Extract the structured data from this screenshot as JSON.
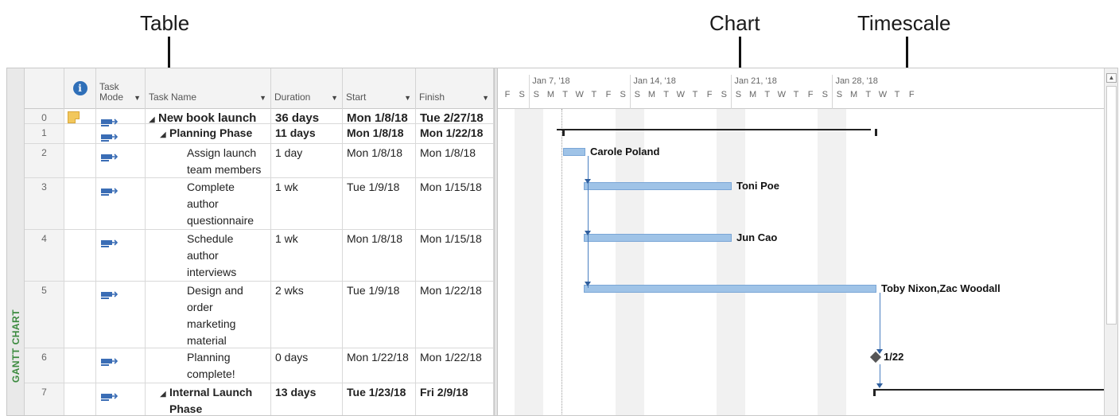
{
  "callouts": {
    "table": "Table",
    "chart": "Chart",
    "timescale": "Timescale"
  },
  "view_bar": {
    "label": "GANTT CHART"
  },
  "columns": {
    "task_mode": "Task\nMode",
    "task_name": "Task Name",
    "duration": "Duration",
    "start": "Start",
    "finish": "Finish",
    "indicator_icon": "info-icon"
  },
  "rows": [
    {
      "id": "0",
      "name": "New book launch",
      "duration": "36 days",
      "start": "Mon 1/8/18",
      "finish": "Tue 2/27/18",
      "bold": true,
      "summary": true,
      "indent": 0,
      "note": true
    },
    {
      "id": "1",
      "name": "Planning Phase",
      "duration": "11 days",
      "start": "Mon 1/8/18",
      "finish": "Mon 1/22/18",
      "bold": true,
      "summary": true,
      "indent": 1
    },
    {
      "id": "2",
      "name": "Assign launch\nteam members",
      "duration": "1 day",
      "start": "Mon 1/8/18",
      "finish": "Mon 1/8/18",
      "indent": 2
    },
    {
      "id": "3",
      "name": "Complete\nauthor\nquestionnaire",
      "duration": "1 wk",
      "start": "Tue 1/9/18",
      "finish": "Mon 1/15/18",
      "indent": 2
    },
    {
      "id": "4",
      "name": "Schedule\nauthor\ninterviews",
      "duration": "1 wk",
      "start": "Mon 1/8/18",
      "finish": "Mon 1/15/18",
      "indent": 2
    },
    {
      "id": "5",
      "name": "Design and\norder\nmarketing\nmaterial",
      "duration": "2 wks",
      "start": "Tue 1/9/18",
      "finish": "Mon 1/22/18",
      "indent": 2
    },
    {
      "id": "6",
      "name": "Planning\ncomplete!",
      "duration": "0 days",
      "start": "Mon 1/22/18",
      "finish": "Mon 1/22/18",
      "indent": 2
    },
    {
      "id": "7",
      "name": "Internal Launch\nPhase",
      "duration": "13 days",
      "start": "Tue 1/23/18",
      "finish": "Fri 2/9/18",
      "bold": true,
      "summary": true,
      "indent": 1
    }
  ],
  "timescale": {
    "weeks": [
      "Jan 7, '18",
      "Jan 14, '18",
      "Jan 21, '18",
      "Jan 28, '18"
    ],
    "days": [
      "F",
      "S",
      "S",
      "M",
      "T",
      "W",
      "T",
      "F",
      "S",
      "S",
      "M",
      "T",
      "W",
      "T",
      "F",
      "S",
      "S",
      "M",
      "T",
      "W",
      "T",
      "F",
      "S",
      "S",
      "M",
      "T",
      "W",
      "T",
      "F"
    ]
  },
  "chart_labels": {
    "r2": "Carole Poland",
    "r3": "Toni Poe",
    "r4": "Jun Cao",
    "r5": "Toby Nixon,Zac Woodall",
    "r6": "1/22"
  },
  "colors": {
    "bar_fill": "#9fc3e7",
    "link": "#4a7fc1",
    "view_bar_text": "#3b8a3e",
    "info_icon": "#2f6fb8",
    "note_icon": "#f2c75c",
    "mode_icon": "#3a6db5"
  }
}
